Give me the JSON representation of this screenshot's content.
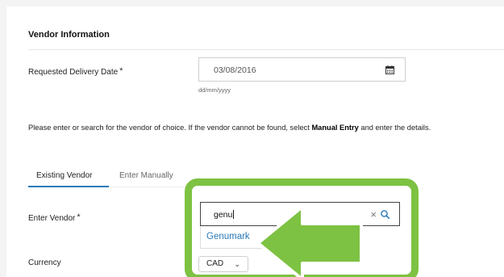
{
  "section": {
    "title": "Vendor Information"
  },
  "delivery": {
    "label": "Requested Delivery Date",
    "required_mark": "*",
    "value": "03/08/2016",
    "format_hint": "dd/mm/yyyy"
  },
  "instructions": {
    "part1": "Please enter or search for the vendor of choice. If the vendor cannot be found, select ",
    "emphasis": "Manual Entry",
    "part2": " and enter the details."
  },
  "tabs": [
    {
      "label": "Existing Vendor",
      "active": true
    },
    {
      "label": "Enter Manually",
      "active": false
    }
  ],
  "vendor": {
    "label": "Enter Vendor",
    "required_mark": "*",
    "value": "genu",
    "clear_symbol": "×",
    "suggestion": "Genumark"
  },
  "currency": {
    "label": "Currency",
    "value": "CAD"
  },
  "colors": {
    "accent": "#2a7ab8",
    "highlight_green": "#7dc242"
  },
  "icons": {
    "calendar": "calendar-icon",
    "clear": "clear-icon",
    "search": "search-icon",
    "chevron": "chevron-down-icon",
    "annotation": "green-arrow"
  }
}
